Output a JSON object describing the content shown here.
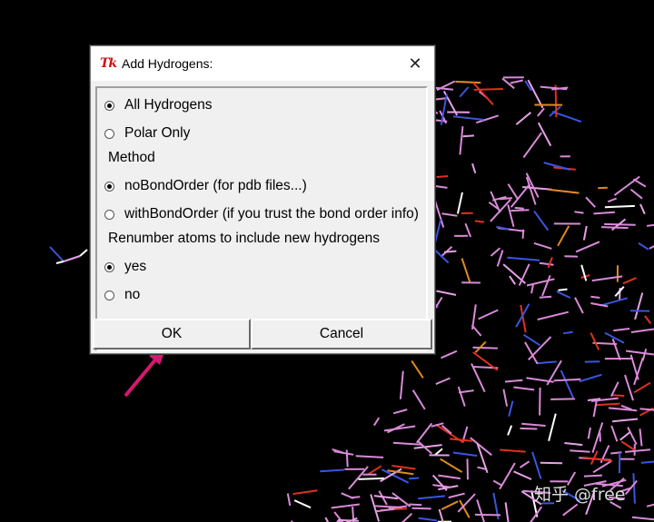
{
  "dialog": {
    "title": "Add Hydrogens:",
    "icon_text": "Tk",
    "close_glyph": "✕",
    "options_hydrogens": [
      {
        "label": "All Hydrogens",
        "selected": true
      },
      {
        "label": "Polar Only",
        "selected": false
      }
    ],
    "method_label": "Method",
    "options_method": [
      {
        "label": "noBondOrder (for pdb files...)",
        "selected": true
      },
      {
        "label": "withBondOrder (if you trust the bond order info)",
        "selected": false
      }
    ],
    "renumber_label": "Renumber atoms to include new hydrogens",
    "options_renumber": [
      {
        "label": "yes",
        "selected": true
      },
      {
        "label": "no",
        "selected": false
      }
    ],
    "ok_label": "OK",
    "cancel_label": "Cancel"
  },
  "watermark": "知乎 @free",
  "colors": {
    "background": "#000000",
    "arrow": "#d6186e",
    "molecule_bonds": [
      "#d98ad8",
      "#e6a1e6",
      "#3a55e0",
      "#e03020",
      "#e08a20",
      "#ffffff"
    ]
  }
}
